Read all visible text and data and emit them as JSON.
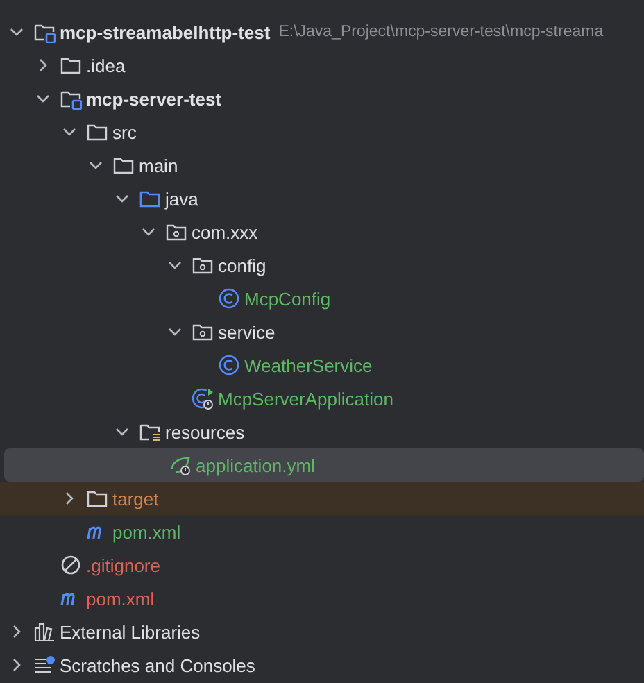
{
  "project_tree": [
    {
      "label": "mcp-streamabelhttp-test",
      "kind": "module",
      "bold": true,
      "path": "E:\\Java_Project\\mcp-server-test\\mcp-streama",
      "expanded": true,
      "selected": false,
      "children": [
        {
          "label": ".idea",
          "kind": "folder",
          "expanded": false,
          "selected": false
        },
        {
          "label": "mcp-server-test",
          "kind": "module",
          "bold": true,
          "expanded": true,
          "selected": false,
          "children": [
            {
              "label": "src",
              "kind": "folder",
              "expanded": true,
              "selected": false,
              "children": [
                {
                  "label": "main",
                  "kind": "folder",
                  "expanded": true,
                  "selected": false,
                  "children": [
                    {
                      "label": "java",
                      "kind": "source",
                      "expanded": true,
                      "selected": false,
                      "children": [
                        {
                          "label": "com.xxx",
                          "kind": "package",
                          "expanded": true,
                          "selected": false,
                          "children": [
                            {
                              "label": "config",
                              "kind": "package",
                              "expanded": true,
                              "selected": false,
                              "children": [
                                {
                                  "label": "McpConfig",
                                  "kind": "class",
                                  "color": "#5fb865",
                                  "selected": false
                                }
                              ]
                            },
                            {
                              "label": "service",
                              "kind": "package",
                              "expanded": true,
                              "selected": false,
                              "children": [
                                {
                                  "label": "WeatherService",
                                  "kind": "class",
                                  "color": "#5fb865",
                                  "selected": false
                                }
                              ]
                            },
                            {
                              "label": "McpServerApplication",
                              "kind": "app",
                              "color": "#5fb865",
                              "selected": false
                            }
                          ]
                        }
                      ]
                    },
                    {
                      "label": "resources",
                      "kind": "resources",
                      "expanded": true,
                      "selected": false,
                      "children": [
                        {
                          "label": "application.yml",
                          "kind": "yaml",
                          "color": "#5fb865",
                          "selected": true
                        }
                      ]
                    }
                  ]
                }
              ]
            },
            {
              "label": "target",
              "kind": "folder",
              "color": "#d08550",
              "ignored": true,
              "expanded": false,
              "selected": false
            },
            {
              "label": "pom.xml",
              "kind": "maven",
              "color": "#5fb865",
              "selected": false
            }
          ]
        },
        {
          "label": ".gitignore",
          "kind": "ignore",
          "color": "#d8655a",
          "selected": false
        },
        {
          "label": "pom.xml",
          "kind": "maven",
          "color": "#d8655a",
          "selected": false
        }
      ]
    },
    {
      "label": "External Libraries",
      "kind": "library",
      "expanded": false,
      "selected": false
    },
    {
      "label": "Scratches and Consoles",
      "kind": "scratches",
      "expanded": false,
      "selected": false
    }
  ]
}
